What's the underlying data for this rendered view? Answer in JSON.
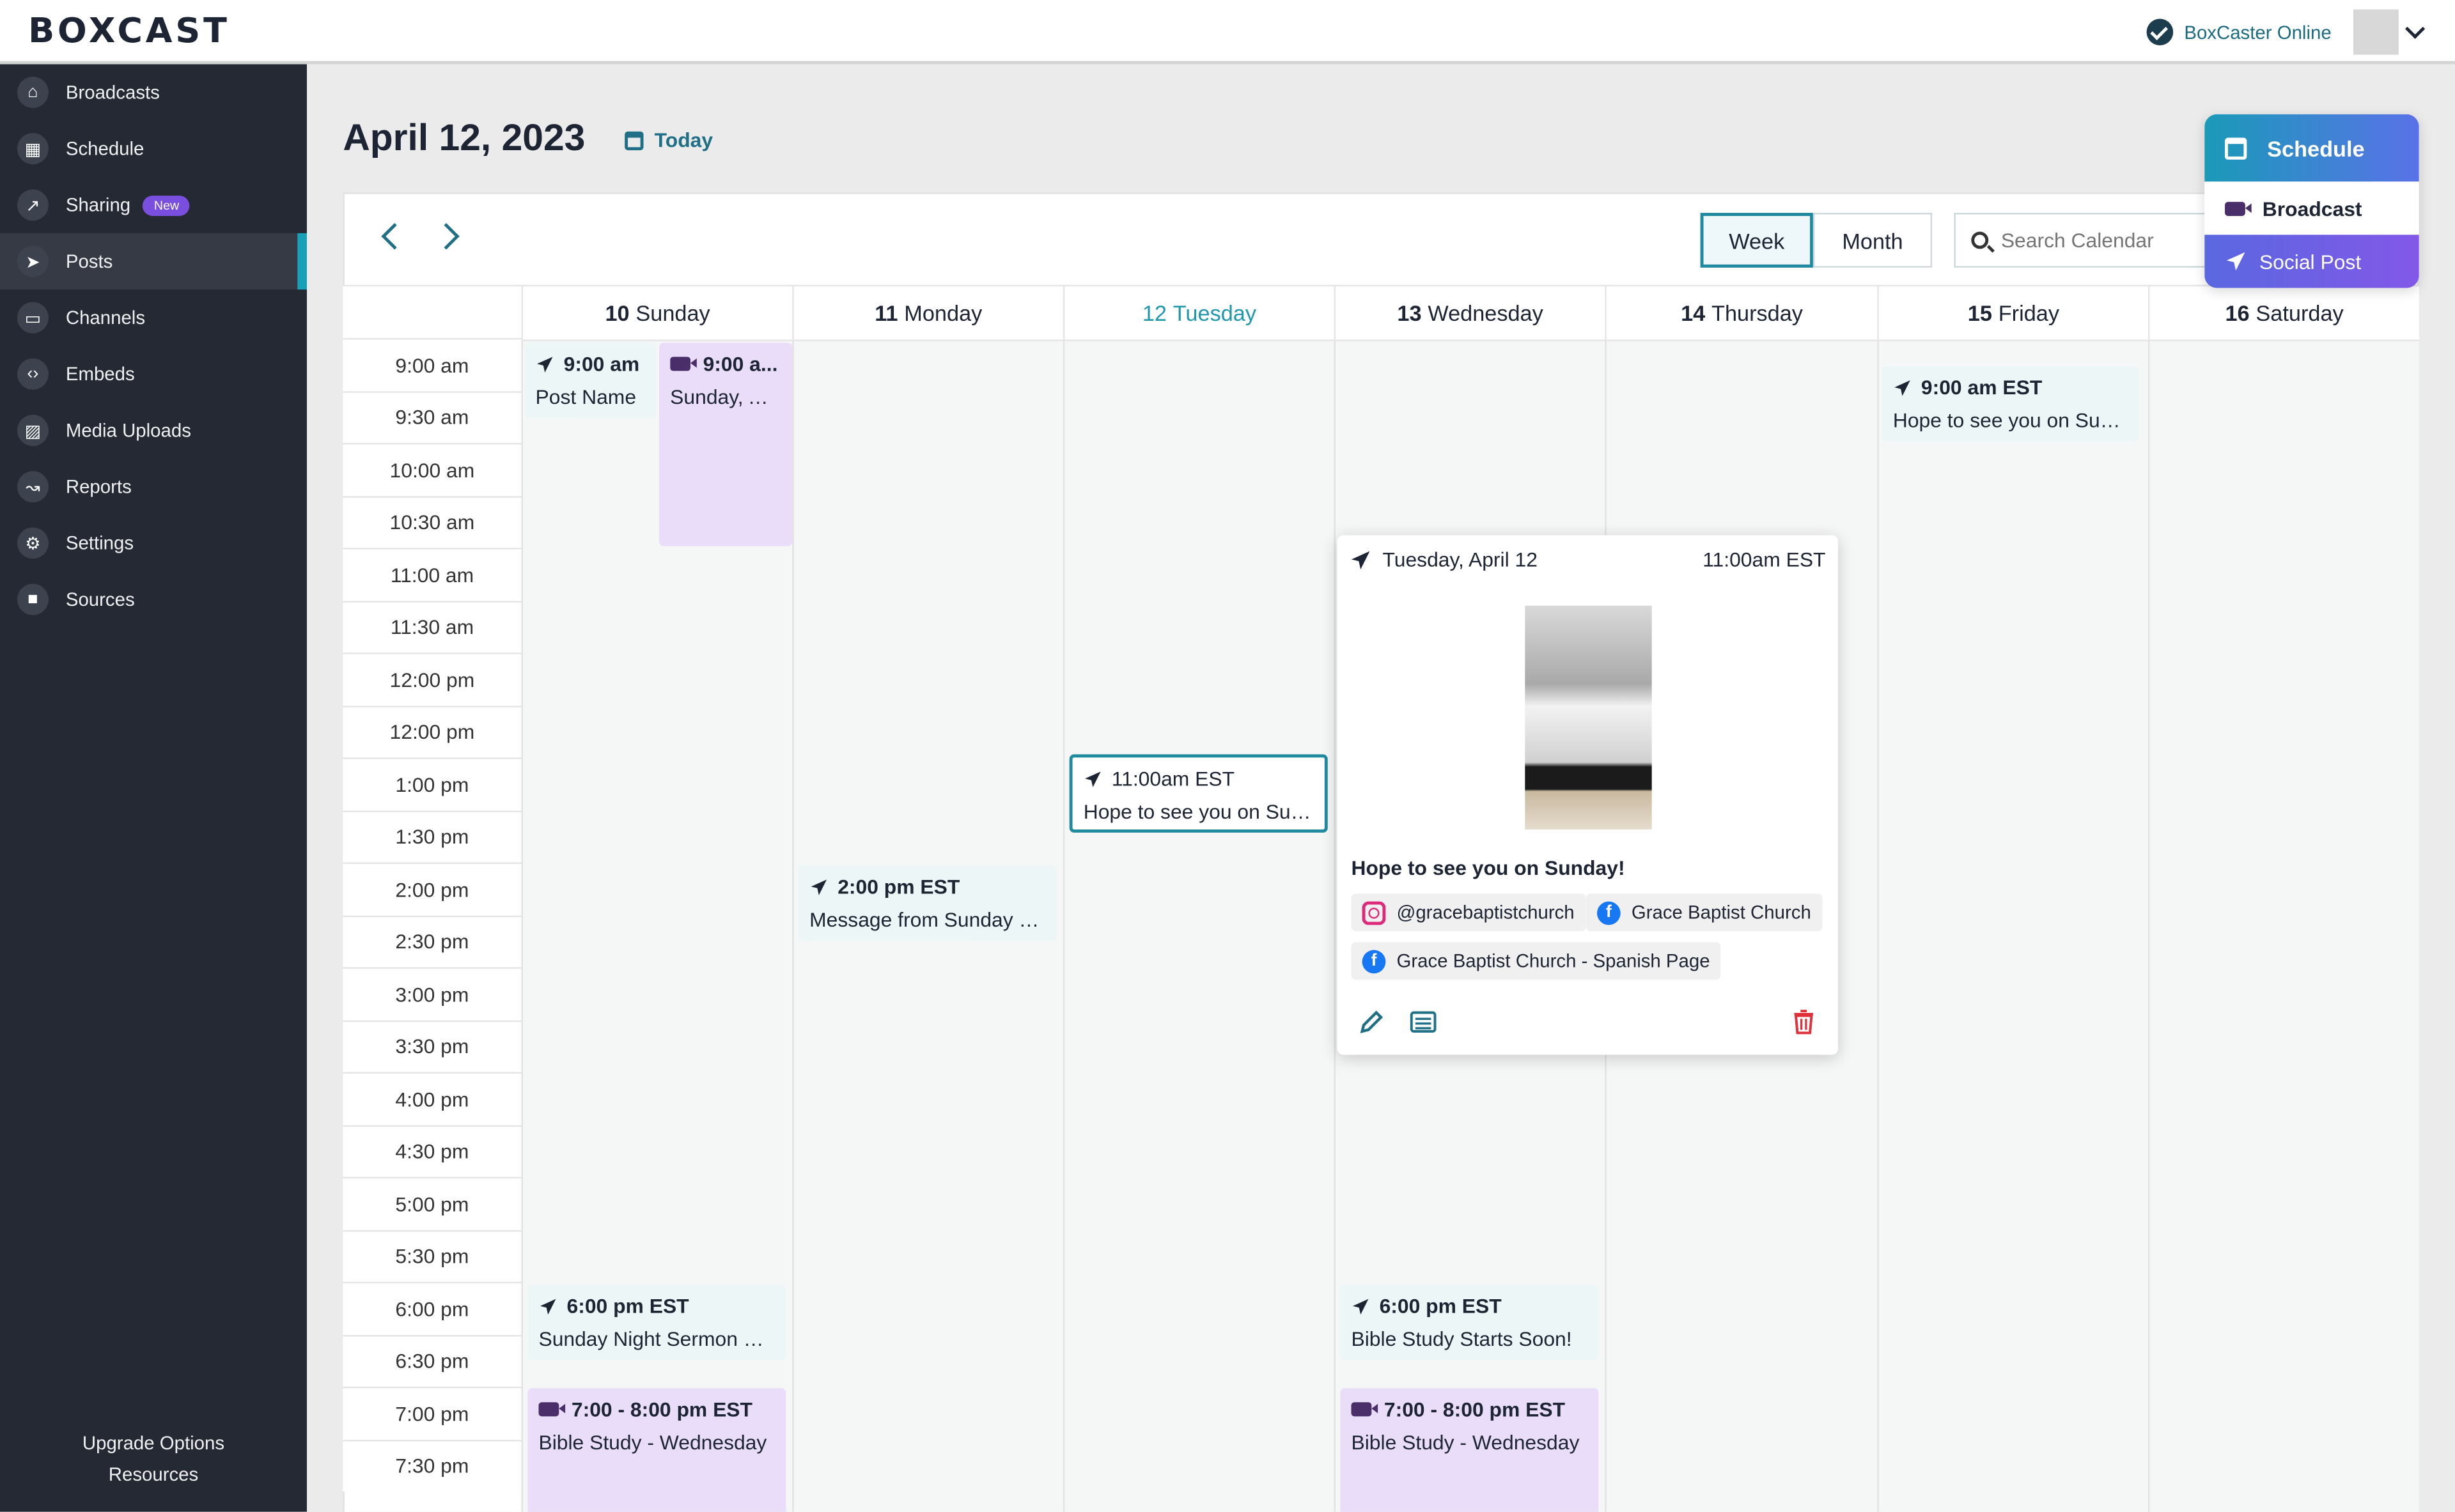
{
  "app": {
    "logo": "BOXCAST",
    "status": "BoxCaster Online"
  },
  "sidebar": {
    "items": [
      {
        "label": "Broadcasts",
        "icon": "home-icon"
      },
      {
        "label": "Schedule",
        "icon": "calendar-icon"
      },
      {
        "label": "Sharing",
        "icon": "share-icon",
        "badge": "New"
      },
      {
        "label": "Posts",
        "icon": "paper-plane-icon",
        "active": true
      },
      {
        "label": "Channels",
        "icon": "monitor-icon"
      },
      {
        "label": "Embeds",
        "icon": "code-icon"
      },
      {
        "label": "Media Uploads",
        "icon": "image-icon"
      },
      {
        "label": "Reports",
        "icon": "chart-icon"
      },
      {
        "label": "Settings",
        "icon": "gear-icon"
      },
      {
        "label": "Sources",
        "icon": "video-icon"
      }
    ],
    "footer": [
      "Upgrade Options",
      "Resources"
    ]
  },
  "header": {
    "date": "April 12, 2023",
    "today": "Today"
  },
  "toolbar": {
    "week": "Week",
    "month": "Month",
    "search_placeholder": "Search Calendar"
  },
  "days": [
    {
      "num": "10",
      "name": "Sunday"
    },
    {
      "num": "11",
      "name": "Monday"
    },
    {
      "num": "12",
      "name": "Tuesday",
      "today": true
    },
    {
      "num": "13",
      "name": "Wednesday"
    },
    {
      "num": "14",
      "name": "Thursday"
    },
    {
      "num": "15",
      "name": "Friday"
    },
    {
      "num": "16",
      "name": "Saturday"
    }
  ],
  "times": [
    "9:00 am",
    "9:30 am",
    "10:00 am",
    "10:30 am",
    "11:00 am",
    "11:30 am",
    "12:00 pm",
    "12:00 pm",
    "1:00 pm",
    "1:30 pm",
    "2:00 pm",
    "2:30 pm",
    "3:00 pm",
    "3:30 pm",
    "4:00 pm",
    "4:30 pm",
    "5:00 pm",
    "5:30 pm",
    "6:00 pm",
    "6:30 pm",
    "7:00 pm",
    "7:30 pm"
  ],
  "events": {
    "e1": {
      "time": "9:00 am",
      "title": "Post Name"
    },
    "e2": {
      "time": "9:00 a...",
      "title": "Sunday, Ap..."
    },
    "e3": {
      "time": "6:00 pm EST",
      "title": "Sunday Night Sermon St..."
    },
    "e4": {
      "time": "7:00 - 8:00 pm EST",
      "title": "Bible Study - Wednesday"
    },
    "e5": {
      "time": "2:00 pm EST",
      "title": "Message from Sunday S..."
    },
    "e6": {
      "time": "11:00am EST",
      "title": "Hope to see you on Sun..."
    },
    "e7": {
      "time": "6:00 pm EST",
      "title": "Bible Study Starts Soon!"
    },
    "e8": {
      "time": "7:00 - 8:00 pm EST",
      "title": "Bible Study - Wednesday"
    },
    "e9": {
      "time": "9:00 am EST",
      "title": "Hope to see you on Sun..."
    }
  },
  "popup": {
    "date": "Tuesday, April 12",
    "time": "11:00am EST",
    "message": "Hope to see you on Sunday!",
    "accounts": [
      "@gracebaptistchurch",
      "Grace Baptist Church",
      "Grace Baptist Church - Spanish Page"
    ]
  },
  "schedule_menu": {
    "title": "Schedule",
    "broadcast": "Broadcast",
    "social": "Social Post"
  },
  "colors": {
    "accent": "#1f8aa0",
    "sidebar": "#242934",
    "broadcast_event": "#e9ddfa",
    "post_event": "#ecf6f7",
    "delete": "#e0303a"
  }
}
